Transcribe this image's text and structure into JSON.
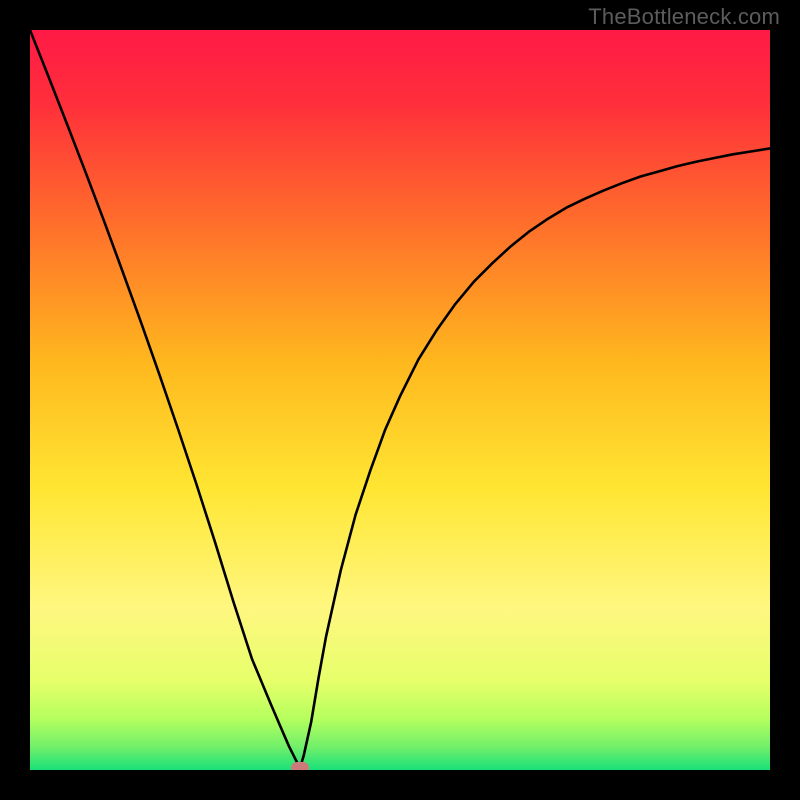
{
  "watermark": "TheBottleneck.com",
  "colors": {
    "top": "#ff1a46",
    "mid_upper": "#ff7e2c",
    "mid": "#ffd31a",
    "mid_lower": "#fff36a",
    "near_bottom": "#c2ff68",
    "bottom": "#18e07a",
    "curve": "#000000",
    "marker": "#cd7b7a",
    "frame": "#000000"
  },
  "chart_data": {
    "type": "line",
    "title": "",
    "xlabel": "",
    "ylabel": "",
    "xlim": [
      0,
      1
    ],
    "ylim": [
      0,
      1
    ],
    "grid": false,
    "legend": null,
    "annotations": [],
    "x": [
      0.0,
      0.025,
      0.05,
      0.075,
      0.1,
      0.125,
      0.15,
      0.175,
      0.2,
      0.225,
      0.25,
      0.275,
      0.3,
      0.325,
      0.34,
      0.35,
      0.355,
      0.36,
      0.365,
      0.37,
      0.38,
      0.39,
      0.4,
      0.42,
      0.44,
      0.46,
      0.48,
      0.5,
      0.525,
      0.55,
      0.575,
      0.6,
      0.625,
      0.65,
      0.675,
      0.7,
      0.725,
      0.75,
      0.775,
      0.8,
      0.825,
      0.85,
      0.875,
      0.9,
      0.925,
      0.95,
      0.975,
      1.0
    ],
    "values": [
      1.0,
      0.937,
      0.873,
      0.808,
      0.742,
      0.674,
      0.605,
      0.534,
      0.461,
      0.386,
      0.308,
      0.227,
      0.15,
      0.09,
      0.055,
      0.032,
      0.022,
      0.012,
      0.003,
      0.02,
      0.065,
      0.125,
      0.18,
      0.27,
      0.345,
      0.405,
      0.46,
      0.505,
      0.555,
      0.595,
      0.63,
      0.66,
      0.685,
      0.708,
      0.728,
      0.745,
      0.76,
      0.772,
      0.783,
      0.793,
      0.802,
      0.809,
      0.816,
      0.822,
      0.827,
      0.832,
      0.836,
      0.84
    ],
    "marker": {
      "x": 0.365,
      "y": 0.003
    },
    "gradient_stops": [
      {
        "pos": 0.0,
        "color": "#ff1a46"
      },
      {
        "pos": 0.1,
        "color": "#ff2f3b"
      },
      {
        "pos": 0.25,
        "color": "#ff6a2c"
      },
      {
        "pos": 0.45,
        "color": "#ffb81e"
      },
      {
        "pos": 0.62,
        "color": "#ffe633"
      },
      {
        "pos": 0.78,
        "color": "#fff780"
      },
      {
        "pos": 0.88,
        "color": "#e6ff6a"
      },
      {
        "pos": 0.93,
        "color": "#b6ff5e"
      },
      {
        "pos": 0.97,
        "color": "#6fef6a"
      },
      {
        "pos": 1.0,
        "color": "#18e07a"
      }
    ]
  }
}
